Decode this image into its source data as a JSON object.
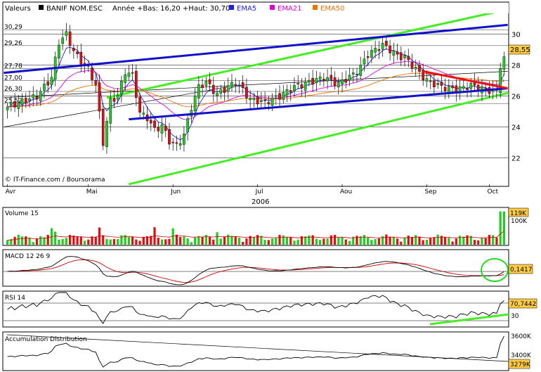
{
  "header": {
    "label": "Valeurs",
    "symbol": "BANIF NOM.ESC",
    "range_text": "Année +Bas: 16,20 +Haut: 30,70",
    "legend": [
      {
        "name": "EMA5",
        "color": "#1e1ee6"
      },
      {
        "name": "EMA21",
        "color": "#e000e0"
      },
      {
        "name": "EMA50",
        "color": "#f07000"
      }
    ]
  },
  "credit": "© IT-Finance.com / Boursorama",
  "year_label": "2006",
  "colors": {
    "up": "#22cc22",
    "down": "#dd1111",
    "channel": "#44ee22",
    "trend_blue": "#1111cc",
    "trend_red": "#ee1111",
    "last_badge": "#ffcc44",
    "grid": "#000000"
  },
  "chart_data": [
    {
      "type": "candlestick",
      "title": "BANIF NOM.ESC",
      "x_labels": [
        "Avr",
        "Mai",
        "Jun",
        "Jul",
        "Aou",
        "Sep",
        "Oct"
      ],
      "ylim": [
        20.3,
        31.3
      ],
      "y_ticks": [
        22,
        24,
        26,
        28,
        30
      ],
      "left_labels": [
        "30,29",
        "29,26",
        "27,78",
        "27,00",
        "26,30",
        "25,52"
      ],
      "last_value": "28,55",
      "indicators": [
        "EMA5",
        "EMA21",
        "EMA50"
      ],
      "anchors": [
        [
          0,
          25.3
        ],
        [
          8,
          26.0
        ],
        [
          12,
          27.2
        ],
        [
          14,
          29.5
        ],
        [
          16,
          30.0
        ],
        [
          18,
          28.9
        ],
        [
          20,
          28.2
        ],
        [
          22,
          27.8
        ],
        [
          24,
          26.7
        ],
        [
          26,
          23.0
        ],
        [
          28,
          25.7
        ],
        [
          30,
          26.0
        ],
        [
          32,
          27.6
        ],
        [
          34,
          27.3
        ],
        [
          36,
          24.9
        ],
        [
          38,
          24.6
        ],
        [
          40,
          23.8
        ],
        [
          42,
          24.1
        ],
        [
          44,
          23.1
        ],
        [
          46,
          22.8
        ],
        [
          48,
          23.5
        ],
        [
          50,
          25.3
        ],
        [
          52,
          26.6
        ],
        [
          54,
          26.9
        ],
        [
          57,
          26.1
        ],
        [
          60,
          26.6
        ],
        [
          62,
          26.9
        ],
        [
          64,
          26.4
        ],
        [
          66,
          25.8
        ],
        [
          70,
          25.6
        ],
        [
          74,
          26.0
        ],
        [
          78,
          26.6
        ],
        [
          82,
          26.9
        ],
        [
          86,
          27.2
        ],
        [
          90,
          26.8
        ],
        [
          94,
          27.4
        ],
        [
          96,
          27.9
        ],
        [
          98,
          28.7
        ],
        [
          100,
          29.0
        ],
        [
          102,
          29.3
        ],
        [
          104,
          29.0
        ],
        [
          106,
          28.6
        ],
        [
          108,
          28.5
        ],
        [
          110,
          28.0
        ],
        [
          114,
          27.0
        ],
        [
          118,
          26.6
        ],
        [
          122,
          26.4
        ],
        [
          126,
          26.7
        ],
        [
          130,
          26.4
        ],
        [
          133,
          26.3
        ],
        [
          134,
          28.0
        ],
        [
          135,
          28.55
        ]
      ]
    },
    {
      "type": "bar",
      "title": "Volume 15",
      "last_value": "119K",
      "ylim": [
        0,
        140
      ],
      "y_tick": "100K"
    },
    {
      "type": "line",
      "title": "MACD 12 26 9",
      "last_value": "0,1417",
      "ylim": [
        -1.2,
        1.2
      ]
    },
    {
      "type": "line",
      "title": "RSI 14",
      "last_value": "70,7442",
      "ylim": [
        20,
        80
      ],
      "levels": [
        70,
        30
      ],
      "level_label": "30"
    },
    {
      "type": "line",
      "title": "Accumulation Distribution",
      "last_value": "3279K",
      "y_ticks": [
        "3600K",
        "3400K"
      ]
    }
  ]
}
